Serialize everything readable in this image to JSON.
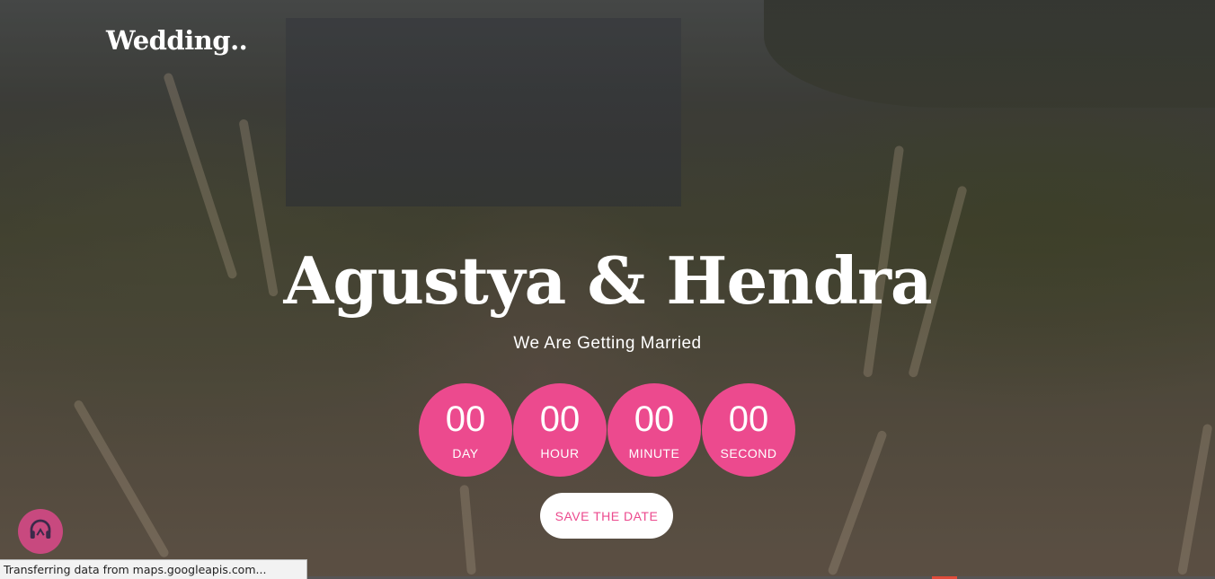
{
  "brand": {
    "name": "Wedding.."
  },
  "hero": {
    "title": "Agustya & Hendra",
    "subtitle": "We Are Getting Married"
  },
  "countdown": [
    {
      "value": "00",
      "label": "DAY"
    },
    {
      "value": "00",
      "label": "HOUR"
    },
    {
      "value": "00",
      "label": "MINUTE"
    },
    {
      "value": "00",
      "label": "SECOND"
    }
  ],
  "cta": {
    "save_label": "SAVE THE DATE"
  },
  "music": {
    "icon": "headphones-icon"
  },
  "status_bar": {
    "text": "Transferring data from maps.googleapis.com..."
  },
  "colors": {
    "accent": "#ec4a8e",
    "music_button": "#c8497f"
  }
}
